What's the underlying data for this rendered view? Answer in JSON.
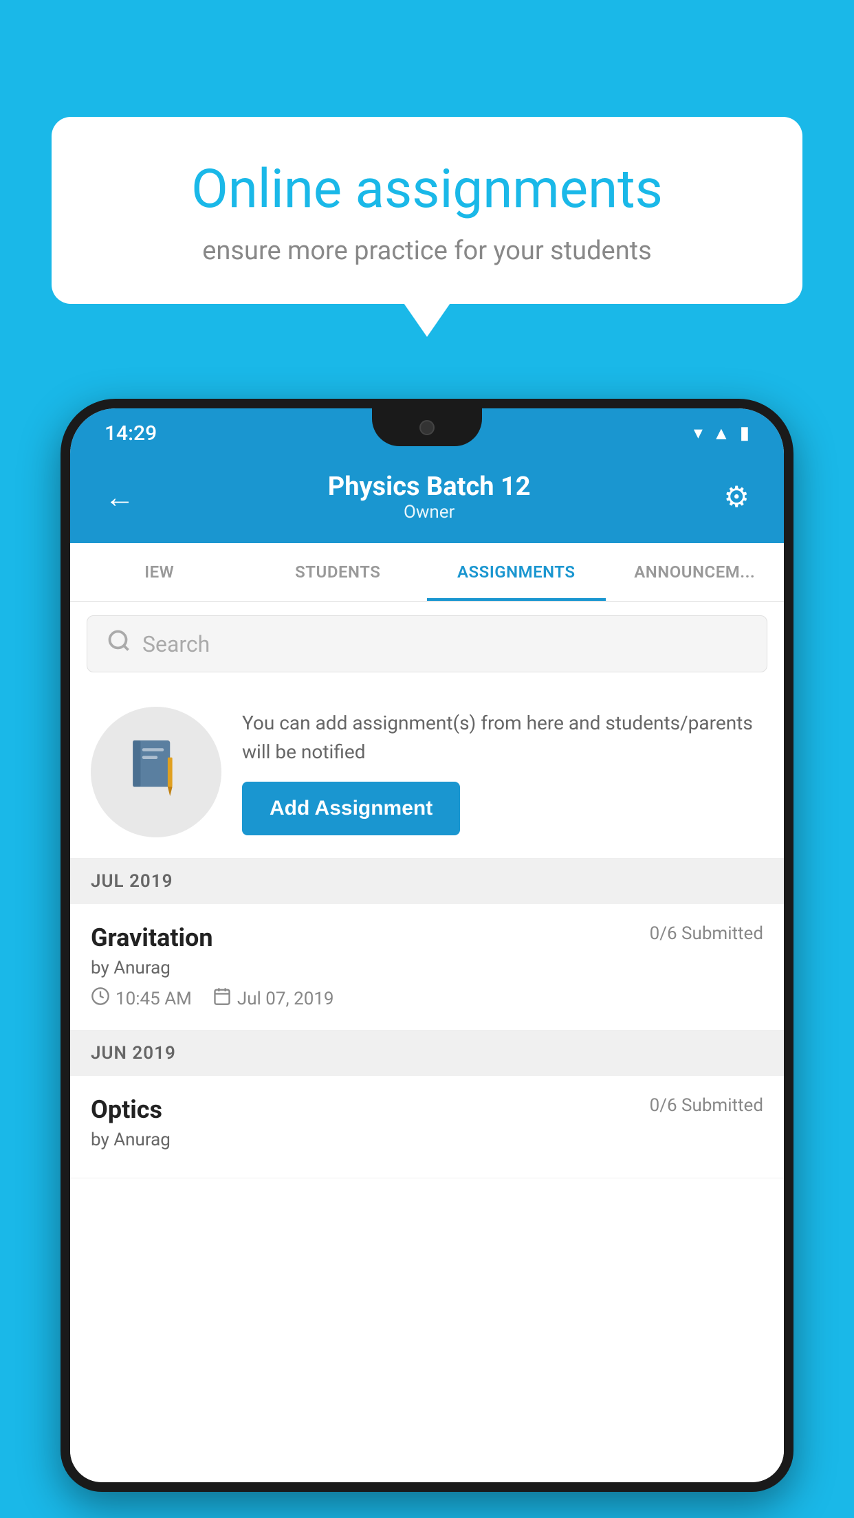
{
  "background_color": "#1ab8e8",
  "speech_bubble": {
    "title": "Online assignments",
    "subtitle": "ensure more practice for your students"
  },
  "status_bar": {
    "time": "14:29",
    "icons": [
      "wifi",
      "signal",
      "battery"
    ]
  },
  "header": {
    "title": "Physics Batch 12",
    "subtitle": "Owner",
    "back_label": "←",
    "settings_label": "⚙"
  },
  "tabs": [
    {
      "label": "IEW",
      "active": false
    },
    {
      "label": "STUDENTS",
      "active": false
    },
    {
      "label": "ASSIGNMENTS",
      "active": true
    },
    {
      "label": "ANNOUNCEM...",
      "active": false
    }
  ],
  "search": {
    "placeholder": "Search"
  },
  "assignment_cta": {
    "description": "You can add assignment(s) from here and students/parents will be notified",
    "button_label": "Add Assignment"
  },
  "months": [
    {
      "label": "JUL 2019",
      "assignments": [
        {
          "name": "Gravitation",
          "submitted": "0/6 Submitted",
          "author": "by Anurag",
          "time": "10:45 AM",
          "date": "Jul 07, 2019"
        }
      ]
    },
    {
      "label": "JUN 2019",
      "assignments": [
        {
          "name": "Optics",
          "submitted": "0/6 Submitted",
          "author": "by Anurag"
        }
      ]
    }
  ]
}
